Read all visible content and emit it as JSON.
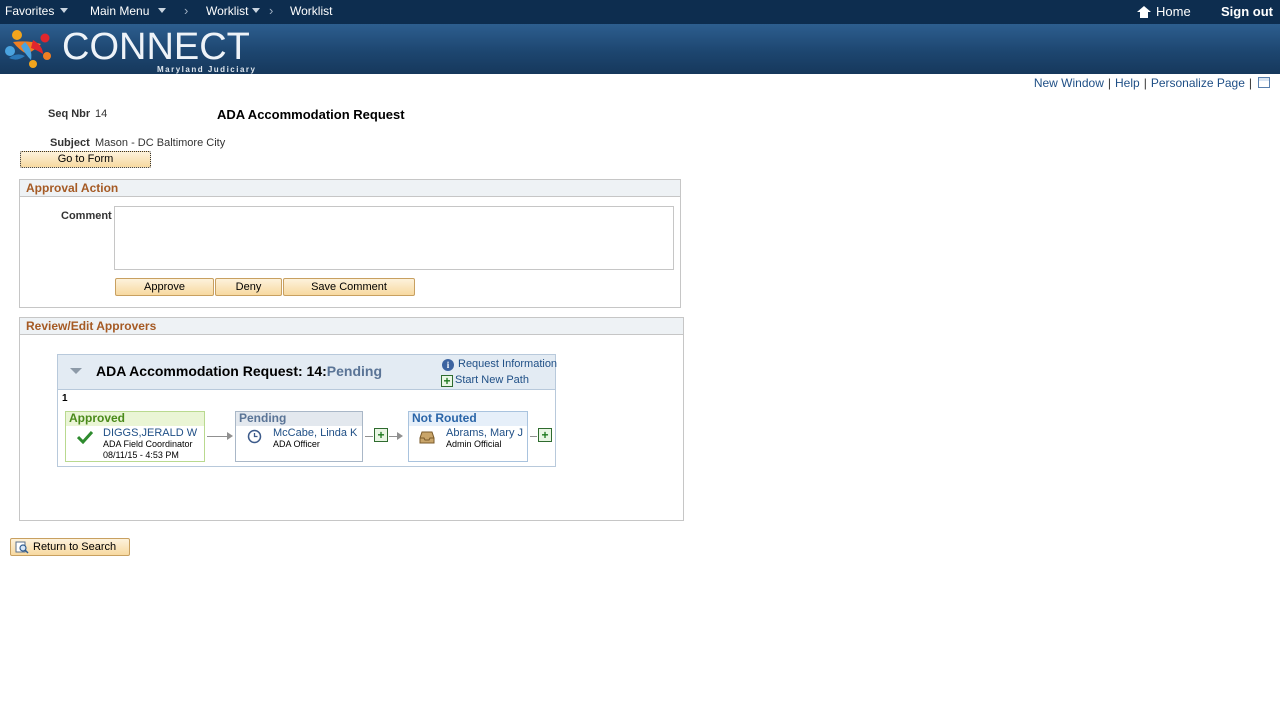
{
  "topnav": {
    "favorites": "Favorites",
    "main_menu": "Main Menu",
    "worklist_menu": "Worklist",
    "worklist_crumb": "Worklist",
    "home": "Home",
    "sign_out": "Sign out"
  },
  "banner": {
    "logo_text": "CONNECT",
    "logo_sub": "Maryland Judiciary"
  },
  "page_links": {
    "new_window": "New Window",
    "help": "Help",
    "personalize": "Personalize Page"
  },
  "form": {
    "seq_label": "Seq Nbr",
    "seq_value": "14",
    "title": "ADA Accommodation Request",
    "subject_label": "Subject",
    "subject_value": "Mason - DC Baltimore City",
    "go_to_form": "Go to Form"
  },
  "approval_action": {
    "header": "Approval Action",
    "comment_label": "Comment",
    "comment_value": "",
    "approve": "Approve",
    "deny": "Deny",
    "save_comment": "Save Comment"
  },
  "review": {
    "header": "Review/Edit Approvers",
    "map_title": "ADA Accommodation Request: 14:",
    "map_status": "Pending",
    "request_info": "Request Information",
    "start_new_path": "Start New Path",
    "path_number": "1",
    "steps": [
      {
        "status": "Approved",
        "name": "DIGGS,JERALD W",
        "role": "ADA Field Coordinator",
        "date": "08/11/15 - 4:53 PM",
        "icon": "check-icon"
      },
      {
        "status": "Pending",
        "name": "McCabe, Linda K",
        "role": "ADA Officer",
        "date": "",
        "icon": "clock-icon"
      },
      {
        "status": "Not Routed",
        "name": "Abrams, Mary J",
        "role": "Admin Official",
        "date": "",
        "icon": "inbox-icon"
      }
    ]
  },
  "footer": {
    "return_to_search": "Return to Search"
  },
  "colors": {
    "nav_bg": "#0d2d4f",
    "group_header_text": "#a55a24",
    "link": "#1f4f86",
    "approved": "#4a8a1a",
    "pending": "#5a7496",
    "not_routed": "#2a65a8"
  }
}
